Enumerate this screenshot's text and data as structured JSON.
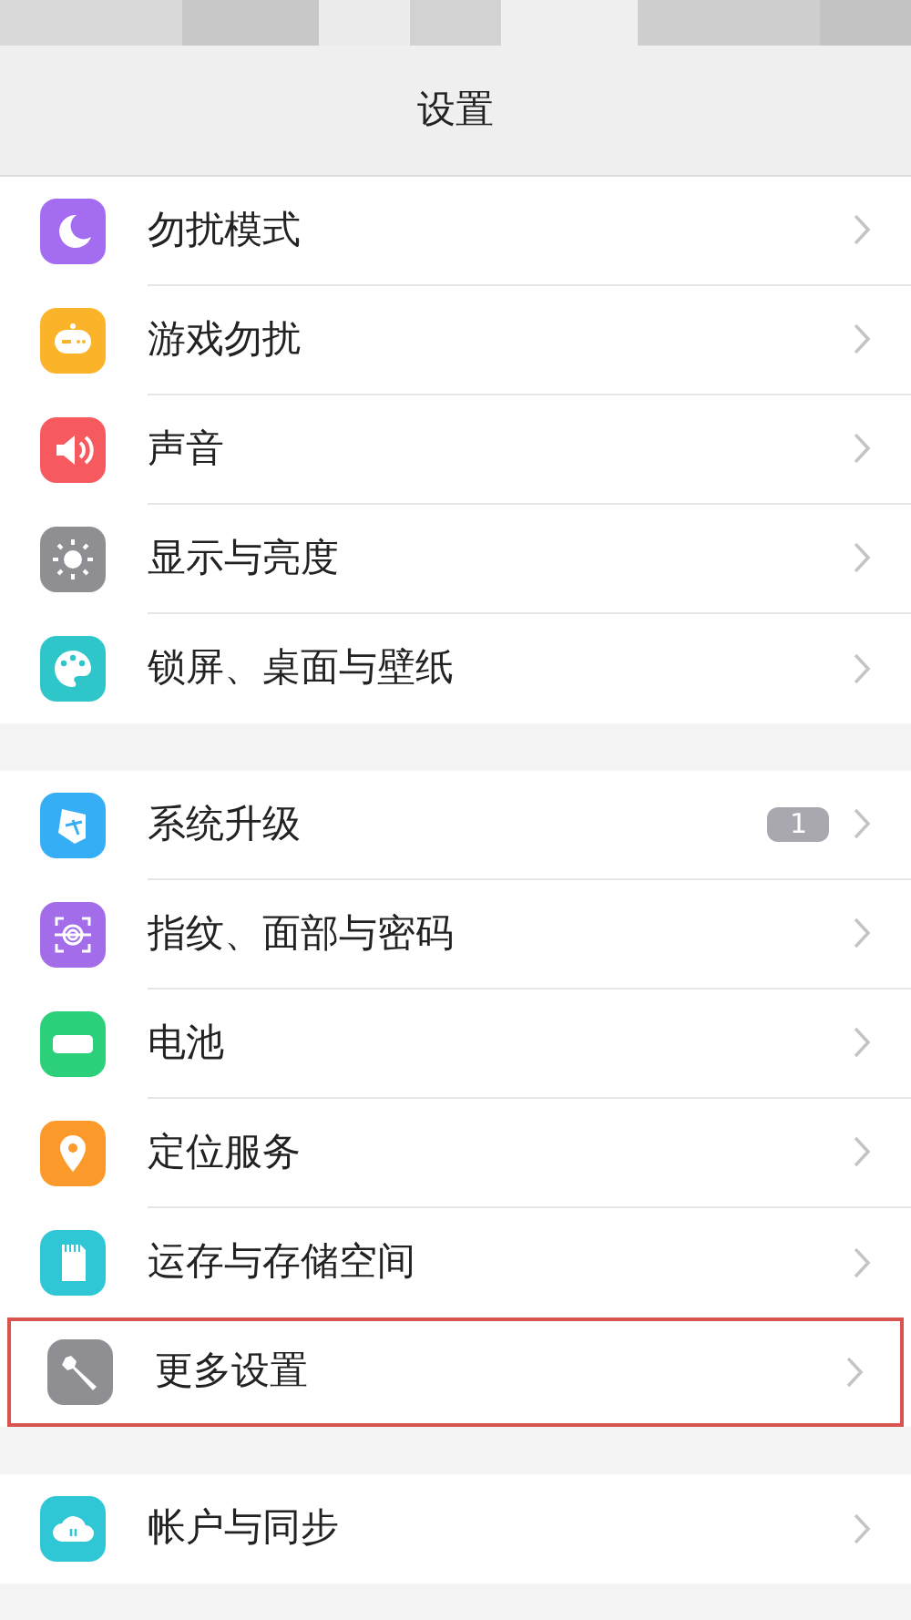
{
  "header": {
    "title": "设置"
  },
  "sections": [
    {
      "items": [
        {
          "label": "勿扰模式",
          "color": "#a46cf0",
          "highlighted": false
        },
        {
          "label": "游戏勿扰",
          "color": "#fbb42a",
          "highlighted": false
        },
        {
          "label": "声音",
          "color": "#f65a5f",
          "highlighted": false
        },
        {
          "label": "显示与亮度",
          "color": "#8e8e93",
          "highlighted": false
        },
        {
          "label": "锁屏、桌面与壁纸",
          "color": "#2fc6c9",
          "highlighted": false
        }
      ]
    },
    {
      "items": [
        {
          "label": "系统升级",
          "color": "#36aef5",
          "badge": "1",
          "highlighted": false
        },
        {
          "label": "指纹、面部与密码",
          "color": "#a36ce8",
          "highlighted": false
        },
        {
          "label": "电池",
          "color": "#2dd07a",
          "highlighted": false
        },
        {
          "label": "定位服务",
          "color": "#fb9a2b",
          "highlighted": false
        },
        {
          "label": "运存与存储空间",
          "color": "#2fc6d6",
          "highlighted": false
        },
        {
          "label": "更多设置",
          "color": "#8e8e93",
          "highlighted": true
        }
      ]
    },
    {
      "items": [
        {
          "label": "帐户与同步",
          "color": "#2fc6d6",
          "highlighted": false
        }
      ]
    }
  ]
}
